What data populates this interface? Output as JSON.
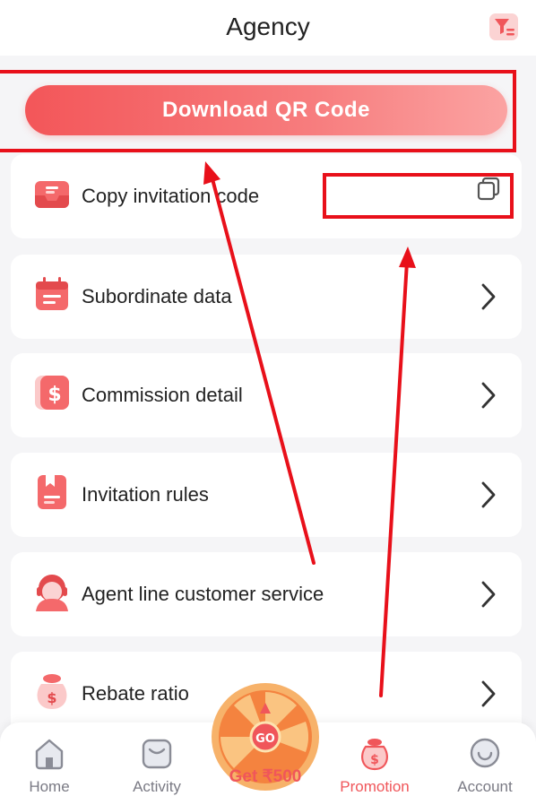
{
  "header": {
    "title": "Agency",
    "filter_icon": "filter-icon"
  },
  "qr_button": {
    "label": "Download QR Code"
  },
  "menu": [
    {
      "label": "Copy invitation code",
      "icon": "inbox-icon",
      "action_icon": "copy-icon"
    },
    {
      "label": "Subordinate data",
      "icon": "calendar-icon",
      "action_icon": "chevron-right-icon"
    },
    {
      "label": "Commission detail",
      "icon": "dollar-icon",
      "action_icon": "chevron-right-icon"
    },
    {
      "label": "Invitation rules",
      "icon": "document-icon",
      "action_icon": "chevron-right-icon"
    },
    {
      "label": "Agent line customer service",
      "icon": "agent-icon",
      "action_icon": "chevron-right-icon"
    },
    {
      "label": "Rebate ratio",
      "icon": "money-bag-icon",
      "action_icon": "chevron-right-icon"
    }
  ],
  "promo": {
    "label": "Get ₹500",
    "badge": "GO"
  },
  "tabbar": [
    {
      "label": "Home",
      "icon": "home-icon"
    },
    {
      "label": "Activity",
      "icon": "activity-icon"
    },
    {
      "label": "Promotion",
      "icon": "money-bag-icon",
      "active": true
    },
    {
      "label": "Account",
      "icon": "account-icon"
    }
  ],
  "colors": {
    "accent": "#f0565a",
    "annotation": "#e8101a",
    "background": "#f5f5f7"
  }
}
